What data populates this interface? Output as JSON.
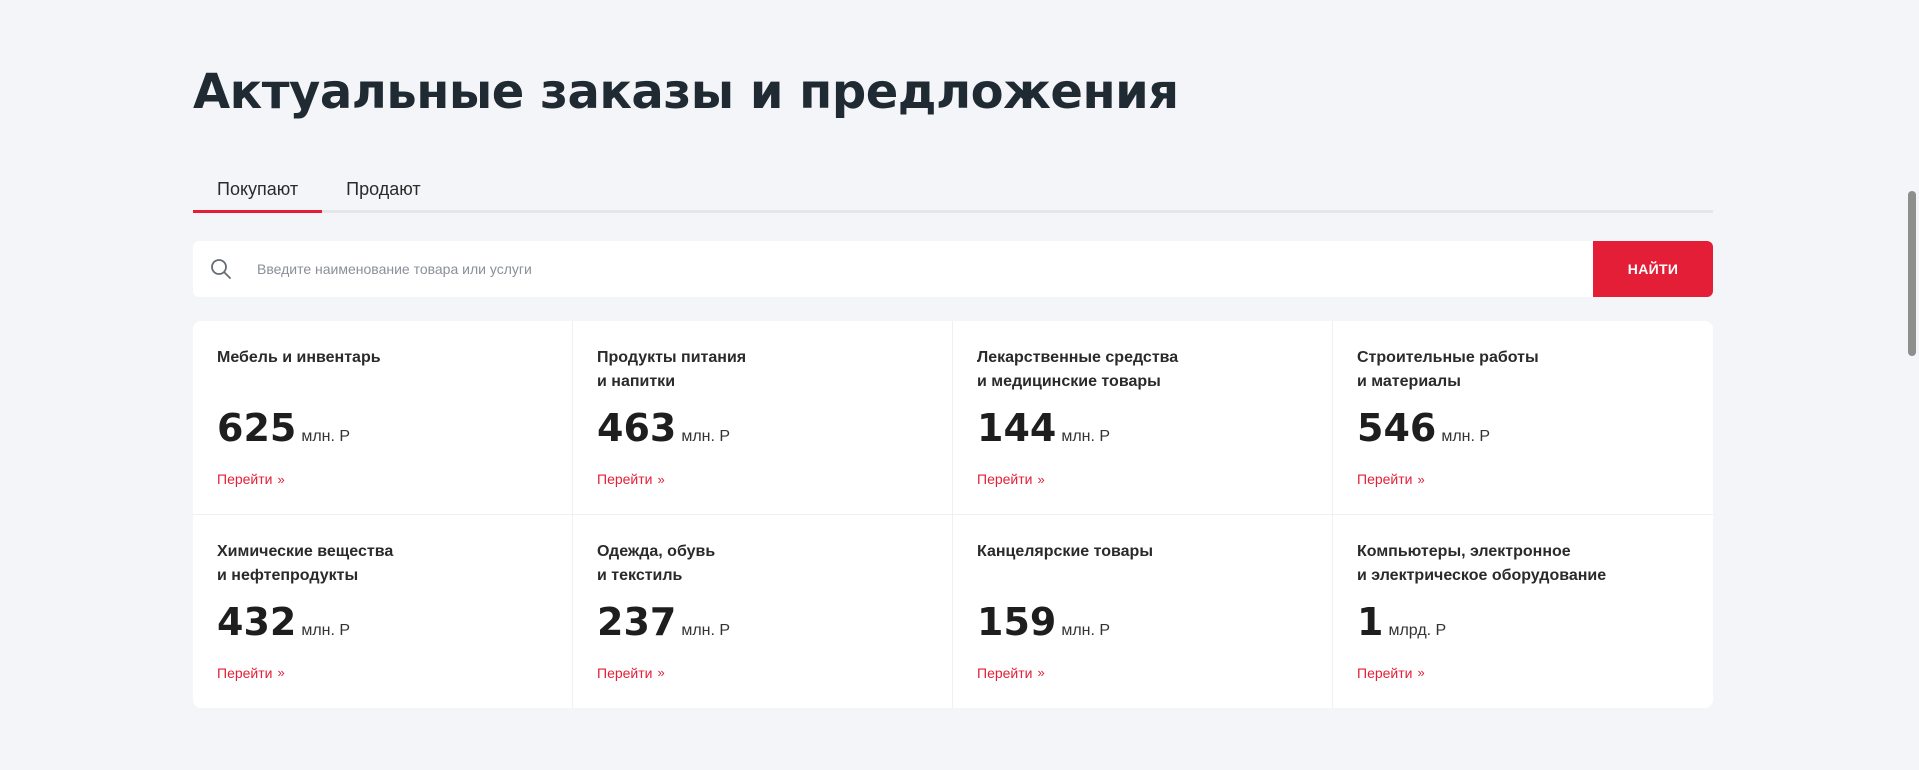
{
  "page": {
    "title": "Актуальные заказы и предложения"
  },
  "tabs": [
    {
      "label": "Покупают",
      "active": true
    },
    {
      "label": "Продают",
      "active": false
    }
  ],
  "search": {
    "placeholder": "Введите наименование товара или услуги",
    "button_label": "НАЙТИ",
    "icon": "search-icon"
  },
  "categories": [
    {
      "title": "Мебель и инвентарь",
      "amount": "625",
      "unit": "млн. Р",
      "link": "Перейти"
    },
    {
      "title": "Продукты питания\nи напитки",
      "amount": "463",
      "unit": "млн. Р",
      "link": "Перейти"
    },
    {
      "title": "Лекарственные средства\nи медицинские товары",
      "amount": "144",
      "unit": "млн. Р",
      "link": "Перейти"
    },
    {
      "title": "Строительные работы\nи материалы",
      "amount": "546",
      "unit": "млн. Р",
      "link": "Перейти"
    },
    {
      "title": "Химические вещества\nи нефтепродукты",
      "amount": "432",
      "unit": "млн. Р",
      "link": "Перейти"
    },
    {
      "title": "Одежда, обувь\nи текстиль",
      "amount": "237",
      "unit": "млн. Р",
      "link": "Перейти"
    },
    {
      "title": "Канцелярские товары",
      "amount": "159",
      "unit": "млн. Р",
      "link": "Перейти"
    },
    {
      "title": "Компьютеры, электронное\nи электрическое оборудование",
      "amount": "1",
      "unit": "млрд. Р",
      "link": "Перейти"
    }
  ],
  "colors": {
    "accent": "#e31e36",
    "background": "#f4f5f9",
    "title": "#1f2a33"
  }
}
